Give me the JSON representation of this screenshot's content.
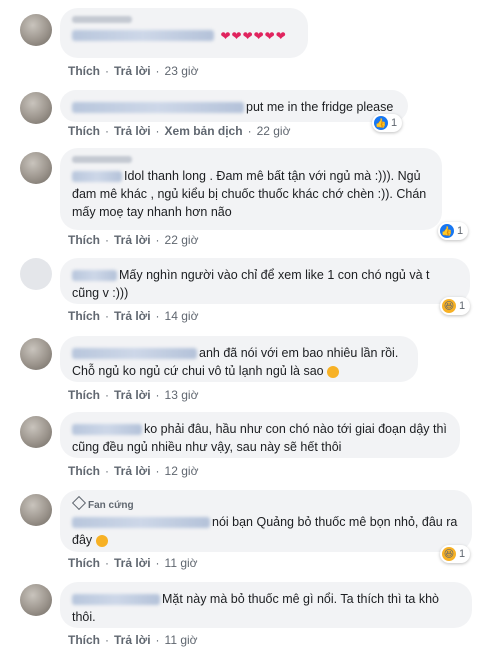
{
  "labels": {
    "like": "Thích",
    "reply": "Trả lời",
    "see_translation": "Xem bản dịch",
    "dot": "·",
    "fan_badge": "Fan cứng"
  },
  "comments": [
    {
      "text": "❤❤❤❤❤❤",
      "time": "23 giờ"
    },
    {
      "text": "put me in the fridge please",
      "time": "22 giờ",
      "reaction_count": "1"
    },
    {
      "text": "Idol thanh long . Đam mê bất tận với ngủ mà :))). Ngủ đam mê khác , ngủ kiểu bị chuốc thuốc khác chớ chèn :)). Chán mấy moẹ tay nhanh hơn não",
      "time": "22 giờ",
      "reaction_count": "1"
    },
    {
      "text": "Mấy nghìn người vào chỉ để xem like 1 con chó ngủ và t cũng v :)))",
      "time": "14 giờ",
      "reaction_count": "1"
    },
    {
      "text": "anh đã nói với em bao nhiêu lần rồi. Chỗ ngủ ko ngủ cứ chui vô tủ lạnh ngủ là sao",
      "time": "13 giờ"
    },
    {
      "text": "ko phải đâu, hầu như con chó nào tới giai đoạn dậy thì cũng đều ngủ nhiều như vậy, sau này sẽ hết thôi",
      "time": "12 giờ"
    },
    {
      "text": "nói bạn Quảng bỏ thuốc mê bọn nhỏ, đâu ra đây",
      "time": "11 giờ",
      "reaction_count": "1"
    },
    {
      "text": "Mặt này mà bỏ thuốc mê gì nổi. Ta thích thì ta khò thôi.",
      "time": "11 giờ"
    }
  ],
  "colors": {
    "like_blue": "#1877f2",
    "bubble_gray": "#f2f3f5",
    "meta_gray": "#606770",
    "haha_yellow": "#f7b125"
  }
}
